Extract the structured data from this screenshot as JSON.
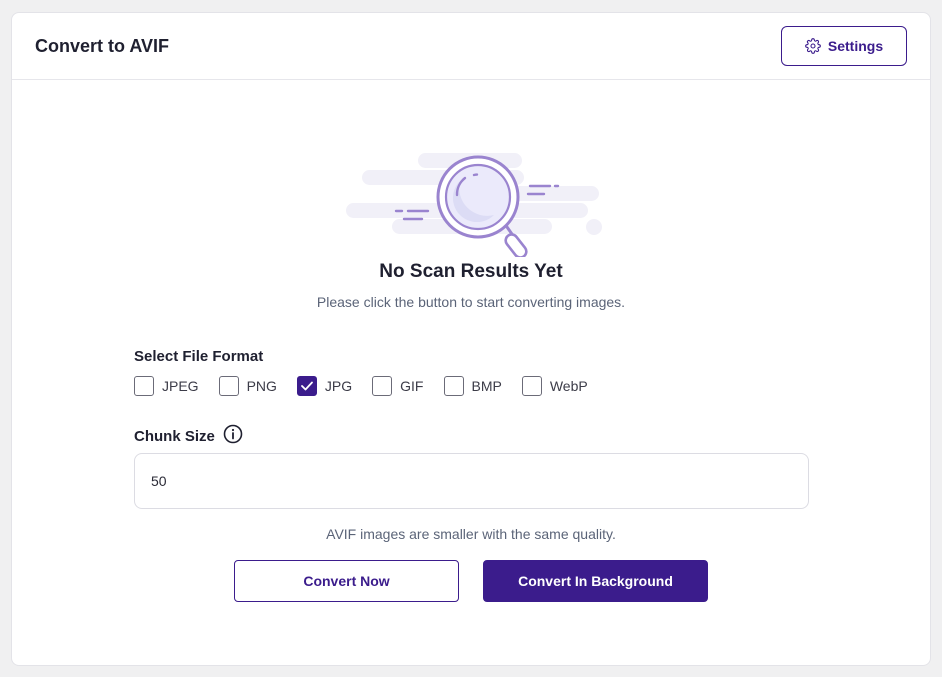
{
  "header": {
    "title": "Convert to AVIF",
    "settings_label": "Settings"
  },
  "empty_state": {
    "title": "No Scan Results Yet",
    "subtitle": "Please click the button to start converting images."
  },
  "file_format": {
    "label": "Select File Format",
    "options": [
      {
        "label": "JPEG",
        "checked": false
      },
      {
        "label": "PNG",
        "checked": false
      },
      {
        "label": "JPG",
        "checked": true
      },
      {
        "label": "GIF",
        "checked": false
      },
      {
        "label": "BMP",
        "checked": false
      },
      {
        "label": "WebP",
        "checked": false
      }
    ]
  },
  "chunk": {
    "label": "Chunk Size",
    "value": "50"
  },
  "note": "AVIF images are smaller with the same quality.",
  "actions": {
    "convert_now": "Convert Now",
    "convert_background": "Convert In Background"
  },
  "colors": {
    "accent": "#3b1c8c",
    "illustration": "#9a84cf"
  }
}
